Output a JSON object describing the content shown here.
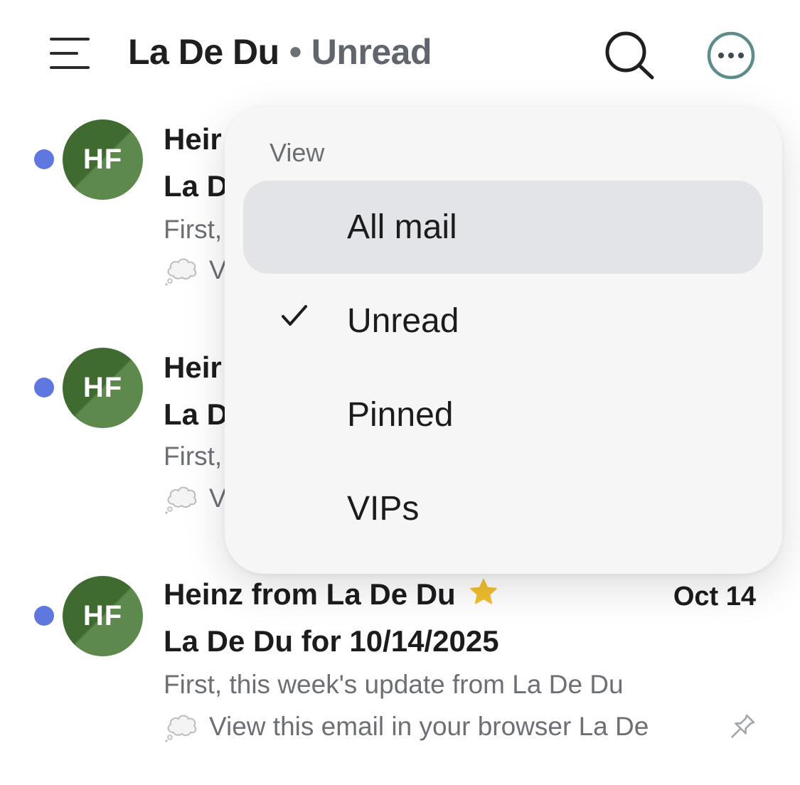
{
  "header": {
    "mailbox": "La De Du",
    "separator": "•",
    "filter": "Unread"
  },
  "emails": [
    {
      "initials": "HF",
      "sender": "Heir",
      "subject": "La D",
      "snippet": "First,",
      "summary": "V"
    },
    {
      "initials": "HF",
      "sender": "Heir",
      "subject": "La D",
      "snippet": "First,",
      "summary": "V"
    },
    {
      "initials": "HF",
      "sender": "Heinz from La De Du",
      "date": "Oct 14",
      "subject": "La De Du for 10/14/2025",
      "snippet": "First, this week's update from La De Du",
      "summary": "View this email in your browser La De"
    }
  ],
  "view_menu": {
    "header": "View",
    "items": [
      {
        "label": "All mail",
        "highlighted": true,
        "checked": false
      },
      {
        "label": "Unread",
        "highlighted": false,
        "checked": true
      },
      {
        "label": "Pinned",
        "highlighted": false,
        "checked": false
      },
      {
        "label": "VIPs",
        "highlighted": false,
        "checked": false
      }
    ]
  },
  "colors": {
    "unread_dot": "#5e78e0",
    "avatar_dark": "#3f6b30",
    "avatar_light": "#5d8a4c",
    "star": "#f2bf2f",
    "more_button_ring": "#5b8d8c"
  },
  "icons": {
    "menu": "hamburger-icon",
    "search": "search-icon",
    "more": "ellipsis-circle-icon",
    "summary": "thought-cloud-icon",
    "vip": "star-icon",
    "pin": "pin-icon",
    "check": "checkmark-icon"
  }
}
